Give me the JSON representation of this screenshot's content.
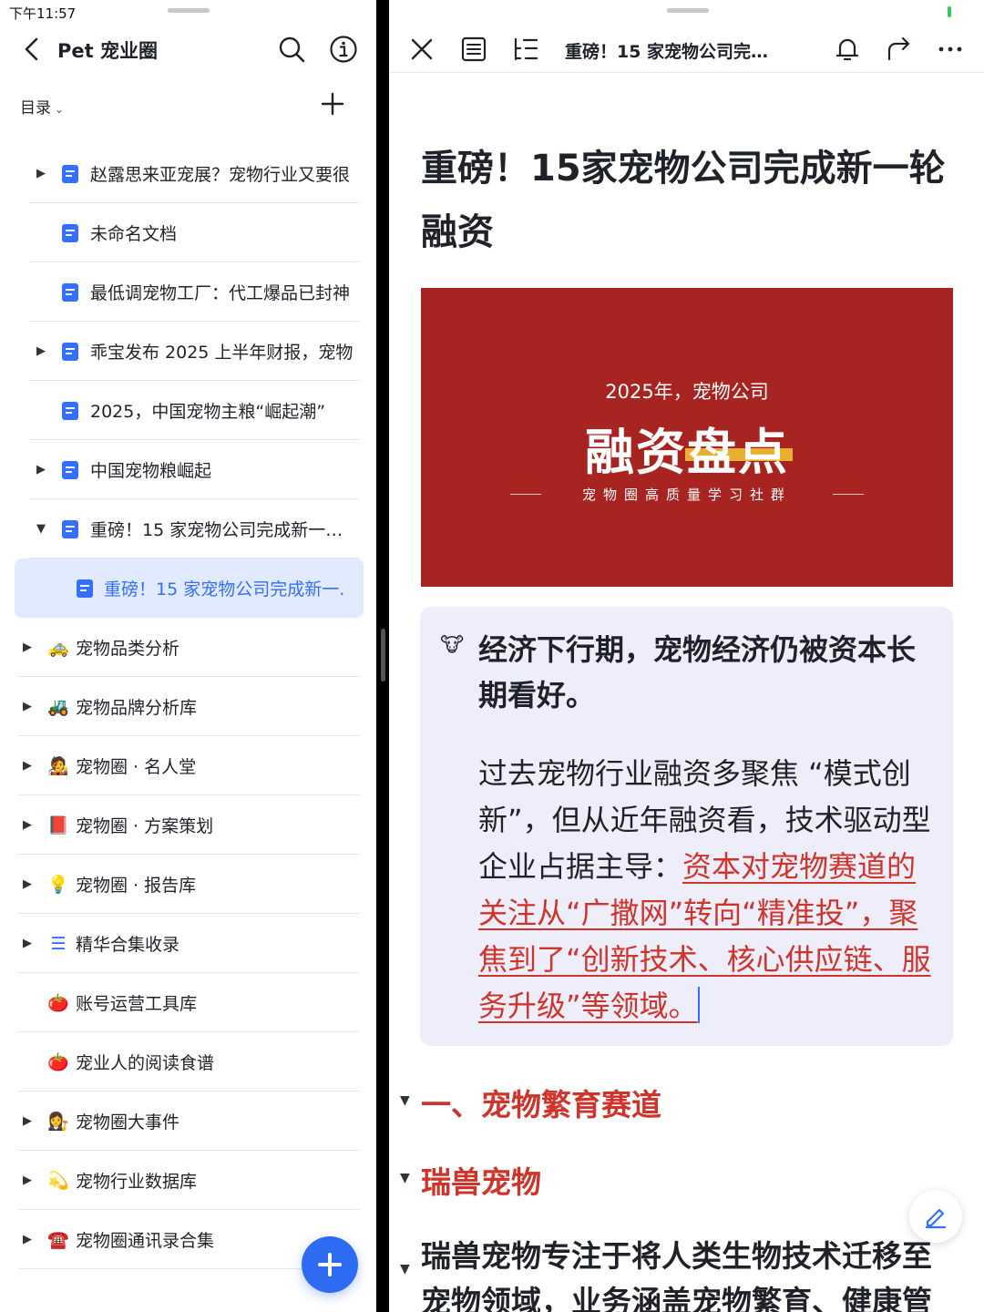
{
  "status": {
    "time": "下午11:57"
  },
  "left": {
    "title": "Pet 宠业圈",
    "directory_label": "目录",
    "sub_items": [
      {
        "label": "赵露思来亚宠展？宠物行业又要很",
        "expandable": true
      },
      {
        "label": "未命名文档",
        "expandable": false
      },
      {
        "label": "最低调宠物工厂：代工爆品已封神",
        "expandable": false
      },
      {
        "label": "乖宝发布 2025 上半年财报，宠物",
        "expandable": true
      },
      {
        "label": "2025，中国宠物主粮“崛起潮”",
        "expandable": false
      },
      {
        "label": "中国宠物粮崛起",
        "expandable": true
      },
      {
        "label": "重磅！15 家宠物公司完成新一…",
        "expandable": true,
        "expanded": true
      }
    ],
    "active_item": {
      "label": "重磅！15 家宠物公司完成新一."
    },
    "top_items": [
      {
        "emoji": "🚕",
        "label": "宠物品类分析",
        "expandable": true
      },
      {
        "emoji": "🚜",
        "label": "宠物品牌分析库",
        "expandable": true
      },
      {
        "emoji": "🧑‍🎤",
        "label": "宠物圈 · 名人堂",
        "expandable": true
      },
      {
        "emoji": "📕",
        "label": "宠物圈 · 方案策划",
        "expandable": true
      },
      {
        "emoji": "💡",
        "label": "宠物圈 · 报告库",
        "expandable": true
      },
      {
        "emoji": "☰",
        "label": "精华合集收录",
        "expandable": true
      },
      {
        "emoji": "🍅",
        "label": "账号运营工具库",
        "expandable": false
      },
      {
        "emoji": "🍅",
        "label": "宠业人的阅读食谱",
        "expandable": false
      },
      {
        "emoji": "👩‍⚖️",
        "label": "宠物圈大事件",
        "expandable": true
      },
      {
        "emoji": "💫",
        "label": "宠物行业数据库",
        "expandable": true
      },
      {
        "emoji": "☎️",
        "label": "宠物圈通讯录合集",
        "expandable": true
      }
    ]
  },
  "right": {
    "header_title": "重磅！15 家宠物公司完…",
    "doc_title": "重磅！15家宠物公司完成新一轮融资",
    "banner": {
      "line1": "2025年，宠物公司",
      "line2": "融资盘点",
      "line3": "宠物圈高质量学习社群"
    },
    "callout": {
      "icon": "🐮",
      "bold_text": "经济下行期，宠物经济仍被资本长期看好。",
      "normal_text": "过去宠物行业融资多聚焦 “模式创新”，但从近年融资看，技术驱动型企业占据主导：",
      "red_text": "资本对宠物赛道的关注从“广撒网”转向“精准投”，聚焦到了“创新技术、核心供应链、服务升级”等领域。"
    },
    "heading1": "一、宠物繁育赛道",
    "heading2": "瑞兽宠物",
    "paragraph": "瑞兽宠物专注于将人类生物技术迁移至宠物领域，业务涵盖宠物繁育、健康管"
  },
  "colors": {
    "accent": "#3370ff",
    "red": "#d0332a",
    "banner": "#a82420",
    "callout_bg": "#eeeefb"
  },
  "icons": [
    "back-icon",
    "search-icon",
    "info-icon",
    "plus-icon",
    "close-icon",
    "outline-icon",
    "toc-icon",
    "bell-icon",
    "share-icon",
    "more-icon",
    "edit-icon"
  ]
}
